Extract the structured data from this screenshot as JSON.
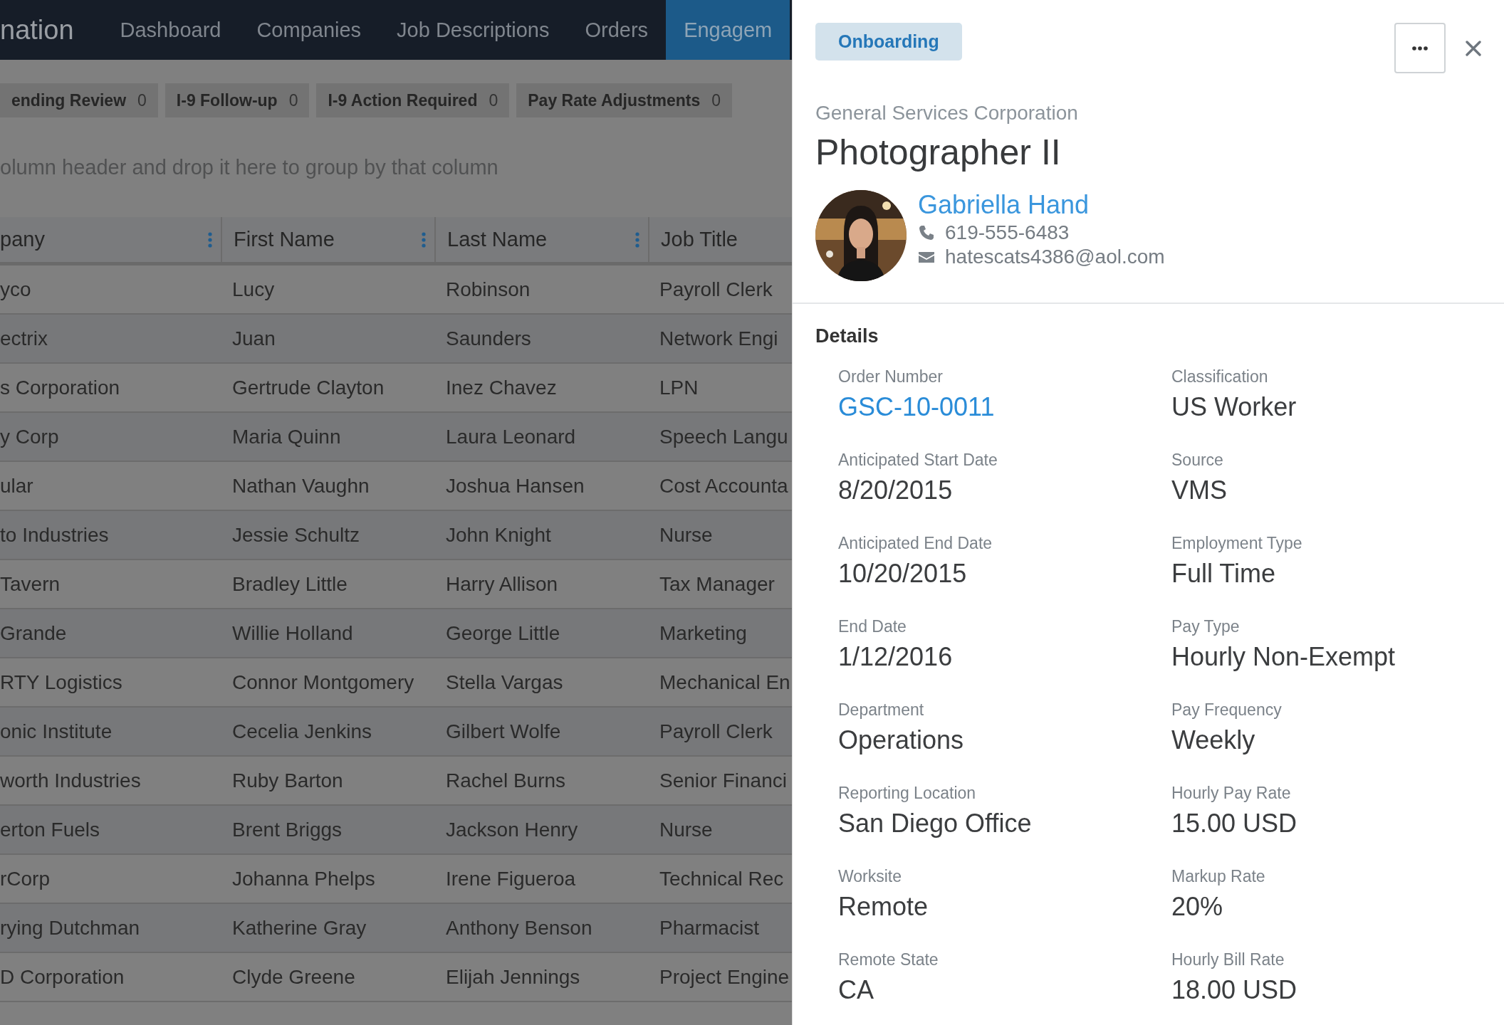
{
  "app": {
    "logo": "nation",
    "nav": [
      {
        "label": "Dashboard",
        "selected": false
      },
      {
        "label": "Companies",
        "selected": false
      },
      {
        "label": "Job Descriptions",
        "selected": false
      },
      {
        "label": "Orders",
        "selected": false
      },
      {
        "label": "Engagem",
        "selected": true
      }
    ]
  },
  "queue_tabs": [
    {
      "label": "ending Review",
      "count": "0"
    },
    {
      "label": "I-9 Follow-up",
      "count": "0"
    },
    {
      "label": "I-9 Action Required",
      "count": "0"
    },
    {
      "label": "Pay Rate Adjustments",
      "count": "0"
    }
  ],
  "group_hint": "olumn header and drop it here to group by that column",
  "grid": {
    "columns": [
      {
        "label": "pany",
        "menu": true
      },
      {
        "label": "First Name",
        "menu": true
      },
      {
        "label": "Last Name",
        "menu": true
      },
      {
        "label": "Job Title",
        "menu": false
      }
    ],
    "rows": [
      [
        "yco",
        "Lucy",
        "Robinson",
        "Payroll Clerk"
      ],
      [
        "ectrix",
        "Juan",
        "Saunders",
        "Network Engi"
      ],
      [
        "s Corporation",
        "Gertrude Clayton",
        "Inez Chavez",
        "LPN"
      ],
      [
        "y Corp",
        "Maria Quinn",
        "Laura Leonard",
        "Speech Langu"
      ],
      [
        "ular",
        "Nathan Vaughn",
        "Joshua Hansen",
        "Cost Accounta"
      ],
      [
        "to Industries",
        "Jessie Schultz",
        "John Knight",
        "Nurse"
      ],
      [
        "Tavern",
        "Bradley Little",
        "Harry Allison",
        "Tax Manager"
      ],
      [
        "Grande",
        "Willie Holland",
        "George Little",
        "Marketing"
      ],
      [
        "RTY Logistics",
        "Connor Montgomery",
        "Stella Vargas",
        "Mechanical En"
      ],
      [
        "onic Institute",
        "Cecelia Jenkins",
        "Gilbert Wolfe",
        "Payroll Clerk"
      ],
      [
        "worth Industries",
        "Ruby Barton",
        "Rachel Burns",
        "Senior Financi"
      ],
      [
        "erton Fuels",
        "Brent Briggs",
        "Jackson Henry",
        "Nurse"
      ],
      [
        "rCorp",
        "Johanna Phelps",
        "Irene Figueroa",
        "Technical Rec"
      ],
      [
        "rying Dutchman",
        "Katherine Gray",
        "Anthony Benson",
        "Pharmacist"
      ],
      [
        "D Corporation",
        "Clyde Greene",
        "Elijah Jennings",
        "Project Engine"
      ]
    ]
  },
  "panel": {
    "status": "Onboarding",
    "company": "General Services Corporation",
    "title": "Photographer II",
    "contact": {
      "name": "Gabriella Hand",
      "phone": "619-555-6483",
      "email": "hatescats4386@aol.com"
    },
    "details_heading": "Details",
    "fields": [
      {
        "label": "Order Number",
        "value": "GSC-10-0011",
        "kind": "link"
      },
      {
        "label": "Classification",
        "value": "US Worker",
        "kind": "text"
      },
      {
        "label": "Anticipated Start Date",
        "value": "8/20/2015",
        "kind": "text"
      },
      {
        "label": "Source",
        "value": "VMS",
        "kind": "text"
      },
      {
        "label": "Anticipated End Date",
        "value": "10/20/2015",
        "kind": "text"
      },
      {
        "label": "Employment Type",
        "value": "Full Time",
        "kind": "text"
      },
      {
        "label": "End Date",
        "value": "1/12/2016",
        "kind": "text"
      },
      {
        "label": "Pay Type",
        "value": "Hourly Non-Exempt",
        "kind": "text"
      },
      {
        "label": "Department",
        "value": "Operations",
        "kind": "text"
      },
      {
        "label": "Pay Frequency",
        "value": "Weekly",
        "kind": "text"
      },
      {
        "label": "Reporting Location",
        "value": "San Diego Office",
        "kind": "text"
      },
      {
        "label": "Hourly Pay Rate",
        "value": "15.00 USD",
        "kind": "text"
      },
      {
        "label": "Worksite",
        "value": "Remote",
        "kind": "text"
      },
      {
        "label": "Markup Rate",
        "value": "20%",
        "kind": "text"
      },
      {
        "label": "Remote State",
        "value": "CA",
        "kind": "text"
      },
      {
        "label": "Hourly Bill Rate",
        "value": "18.00 USD",
        "kind": "text"
      }
    ]
  }
}
